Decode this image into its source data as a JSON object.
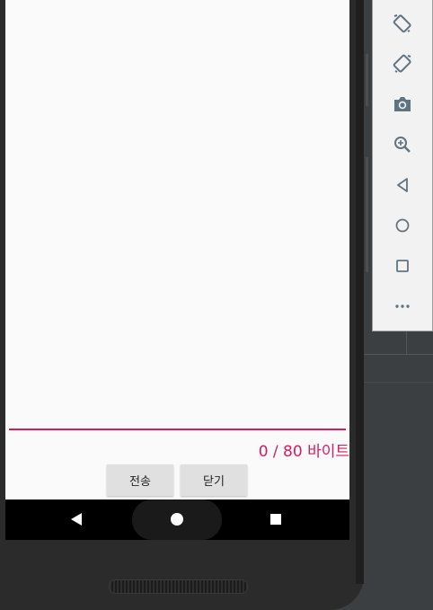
{
  "screen": {
    "byte_counter": "0 / 80 바이트",
    "send_label": "전송",
    "close_label": "닫기",
    "accent_color": "#d81b60"
  },
  "navbar": {
    "back": "back-icon",
    "home": "home-icon",
    "recents": "recents-icon"
  },
  "toolbar": {
    "items": [
      "rotate-left-icon",
      "rotate-right-icon",
      "camera-icon",
      "zoom-icon",
      "back-icon",
      "home-icon",
      "overview-icon",
      "more-icon"
    ]
  }
}
